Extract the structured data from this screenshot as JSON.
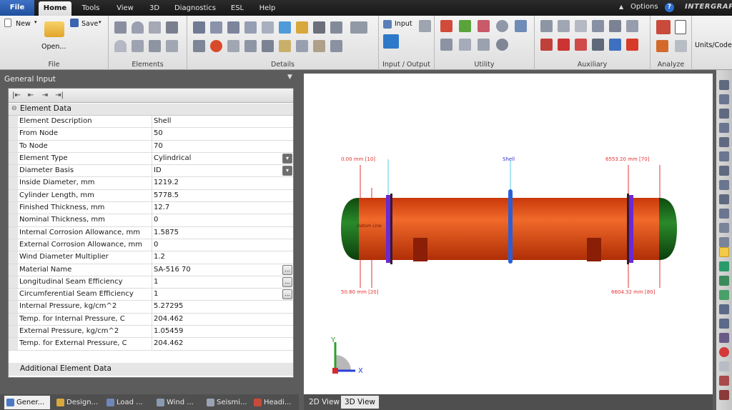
{
  "menu": {
    "tabs": [
      "File",
      "Home",
      "Tools",
      "View",
      "3D",
      "Diagnostics",
      "ESL",
      "Help"
    ],
    "options_label": "Options",
    "help_glyph": "?",
    "brand": "INTERGRAPH"
  },
  "ribbon": {
    "file_group": {
      "new_label": "New",
      "open_label": "Open...",
      "save_label": "Save",
      "group_label": "File"
    },
    "elements_label": "Elements",
    "details_label": "Details",
    "io_group": {
      "input_label": "Input",
      "group_label": "Input / Output"
    },
    "utility_label": "Utility",
    "auxiliary_label": "Auxiliary",
    "analyze_label": "Analyze",
    "units_label": "Units/Code"
  },
  "panel": {
    "title": "General Input",
    "group_title": "Element Data",
    "rows": [
      {
        "label": "Element Description",
        "value": "Shell",
        "btn": ""
      },
      {
        "label": "From Node",
        "value": "50",
        "btn": ""
      },
      {
        "label": "To Node",
        "value": "70",
        "btn": ""
      },
      {
        "label": "Element Type",
        "value": "Cylindrical",
        "btn": "dropdown"
      },
      {
        "label": "Diameter Basis",
        "value": "ID",
        "btn": "dropdown"
      },
      {
        "label": "Inside Diameter, mm",
        "value": "1219.2",
        "btn": ""
      },
      {
        "label": "Cylinder Length, mm",
        "value": "5778.5",
        "btn": ""
      },
      {
        "label": "Finished Thickness, mm",
        "value": "12.7",
        "btn": ""
      },
      {
        "label": "Nominal Thickness, mm",
        "value": "0",
        "btn": ""
      },
      {
        "label": "Internal Corrosion Allowance, mm",
        "value": "1.5875",
        "btn": ""
      },
      {
        "label": "External Corrosion Allowance, mm",
        "value": "0",
        "btn": ""
      },
      {
        "label": "Wind Diameter Multiplier",
        "value": "1.2",
        "btn": ""
      },
      {
        "label": "Material Name",
        "value": "SA-516 70",
        "btn": "ellipsis"
      },
      {
        "label": "Longitudinal Seam Efficiency",
        "value": "1",
        "btn": "ellipsis"
      },
      {
        "label": "Circumferential Seam Efficiency",
        "value": "1",
        "btn": "ellipsis"
      },
      {
        "label": "Internal Pressure, kg/cm^2",
        "value": "5.27295",
        "btn": ""
      },
      {
        "label": "Temp. for Internal Pressure, C",
        "value": "204.462",
        "btn": ""
      },
      {
        "label": "External Pressure, kg/cm^2",
        "value": "1.05459",
        "btn": ""
      },
      {
        "label": "Temp. for External Pressure, C",
        "value": "204.462",
        "btn": ""
      }
    ],
    "additional_title": "Additional Element Data"
  },
  "bottom_tabs": [
    "Gener...",
    "Design...",
    "Load ...",
    "Wind ...",
    "Seismi...",
    "Headi..."
  ],
  "view_tabs": [
    "2D View",
    "3D View"
  ],
  "model": {
    "left_top_dim": "0.00 mm  [10]",
    "shell_label": "Shell",
    "right_top_dim": "6553.20 mm  [70]",
    "left_bottom_dim": "50.80 mm  [20]",
    "right_bottom_dim": "6604.32 mm  [80]",
    "datum_label": "Datum Line",
    "axis_y": "Y",
    "axis_x": "X",
    "colors": {
      "shell": "#e2470f",
      "head": "#1e6e1e",
      "ring": "#6a2ad4",
      "nozzle": "#2a5fd8",
      "dim": "#e53030",
      "shell_label": "#3333cc"
    }
  },
  "ellipsis_glyph": "...",
  "dropdown_glyph": "▾"
}
